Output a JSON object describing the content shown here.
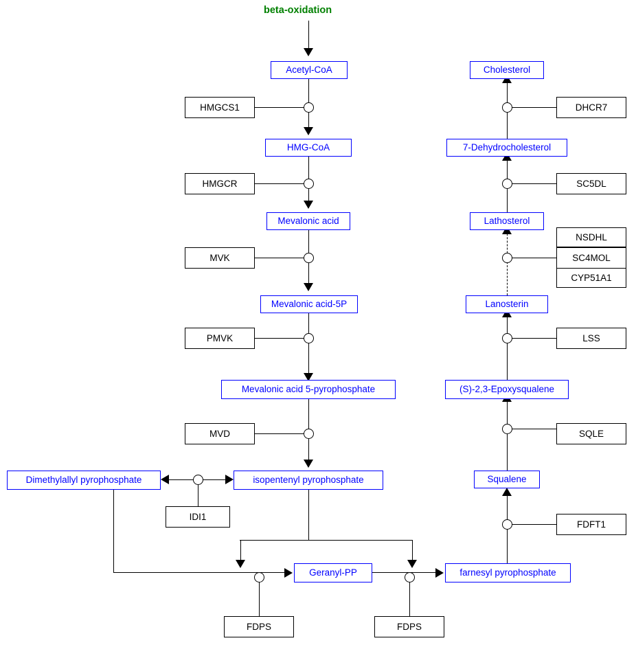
{
  "diagram": {
    "title": "beta-oxidation",
    "title_color": "#008000",
    "metabolite_color": "#0000ff",
    "enzyme_color": "#000000",
    "background": "#ffffff"
  },
  "metabolites": {
    "acetyl_coa": "Acetyl-CoA",
    "hmg_coa": "HMG-CoA",
    "mevalonic_acid": "Mevalonic acid",
    "mevalonic_acid_5p": "Mevalonic acid-5P",
    "mevalonic_acid_5pp": "Mevalonic acid 5-pyrophosphate",
    "ipp": "isopentenyl pyrophosphate",
    "dmapp": "Dimethylallyl pyrophosphate",
    "geranyl_pp": "Geranyl-PP",
    "farnesyl_pp": "farnesyl pyrophosphate",
    "squalene": "Squalene",
    "epoxysqualene": "(S)-2,3-Epoxysqualene",
    "lanosterin": "Lanosterin",
    "lathosterol": "Lathosterol",
    "dehydrocholesterol": "7-Dehydrocholesterol",
    "cholesterol": "Cholesterol"
  },
  "enzymes": {
    "hmgcs1": "HMGCS1",
    "hmgcr": "HMGCR",
    "mvk": "MVK",
    "pmvk": "PMVK",
    "mvd": "MVD",
    "idi1": "IDI1",
    "fdps_left": "FDPS",
    "fdps_right": "FDPS",
    "fdft1": "FDFT1",
    "sqle": "SQLE",
    "lss": "LSS",
    "nsdhl": "NSDHL",
    "sc4mol": "SC4MOL",
    "cyp51a1": "CYP51A1",
    "sc5dl": "SC5DL",
    "dhcr7": "DHCR7"
  }
}
